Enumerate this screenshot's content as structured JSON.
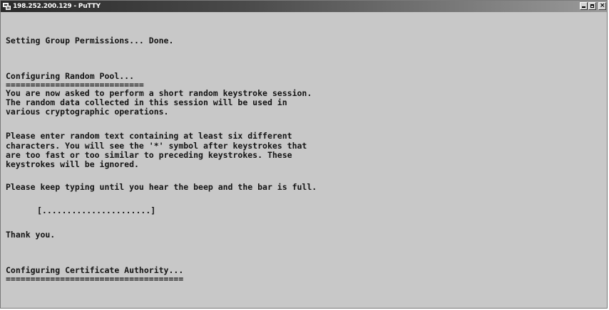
{
  "window": {
    "title": "198.252.200.129 - PuTTY",
    "icon": "putty-icon",
    "controls": {
      "minimize_icon": "minimize-icon",
      "maximize_icon": "maximize-icon",
      "close_icon": "close-icon"
    }
  },
  "terminal": {
    "line_group_permissions": "Setting Group Permissions... Done.",
    "line_random_pool_heading": "Configuring Random Pool...",
    "line_random_pool_rule": "============================",
    "line_keystroke_intro_1": "You are now asked to perform a short random keystroke session.",
    "line_keystroke_intro_2": "The random data collected in this session will be used in",
    "line_keystroke_intro_3": "various cryptographic operations.",
    "line_instructions_1": "Please enter random text containing at least six different",
    "line_instructions_2": "characters. You will see the '*' symbol after keystrokes that",
    "line_instructions_3": "are too fast or too similar to preceding keystrokes. These",
    "line_instructions_4": "keystrokes will be ignored.",
    "line_keep_typing": "Please keep typing until you hear the beep and the bar is full.",
    "progress_bar": "[......................]",
    "line_thank_you": "Thank you.",
    "line_ca_heading": "Configuring Certificate Authority...",
    "line_ca_rule": "===================================="
  },
  "colors": {
    "terminal_background": "#c8c8c8",
    "terminal_text": "#141414"
  }
}
